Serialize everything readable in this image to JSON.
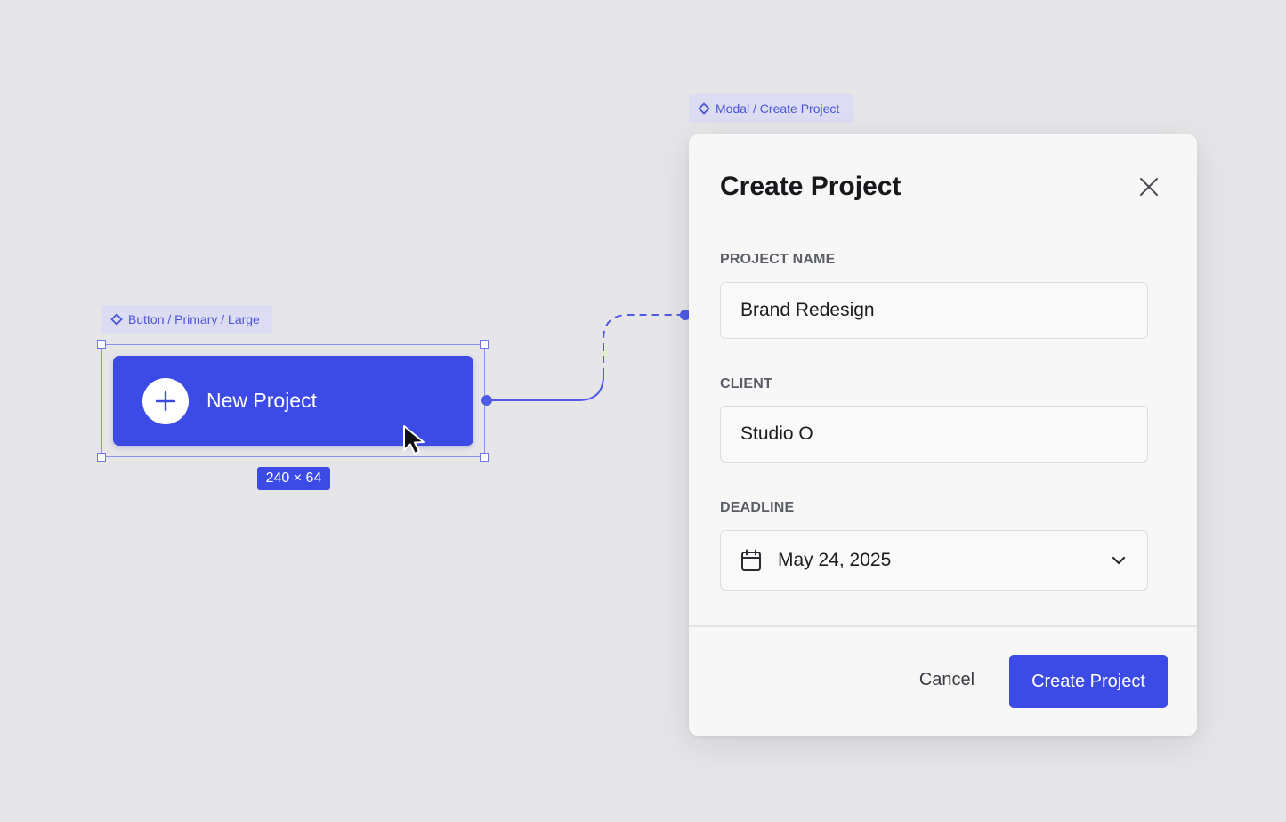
{
  "canvas": {
    "button_component_tag": "Button / Primary / Large",
    "modal_component_tag": "Modal / Create Project",
    "size_badge": "240 × 64",
    "accent_color": "#3d4be6"
  },
  "trigger_button": {
    "label": "New Project",
    "icon": "plus-icon"
  },
  "modal": {
    "title": "Create Project",
    "close_icon": "close-icon",
    "fields": {
      "project_name": {
        "label": "PROJECT NAME",
        "value": "Brand Redesign"
      },
      "client": {
        "label": "CLIENT",
        "value": "Studio O"
      },
      "deadline": {
        "label": "DEADLINE",
        "value": "May 24, 2025",
        "icon": "calendar-icon",
        "dropdown_icon": "chevron-down-icon"
      }
    },
    "cancel_label": "Cancel",
    "submit_label": "Create Project"
  }
}
